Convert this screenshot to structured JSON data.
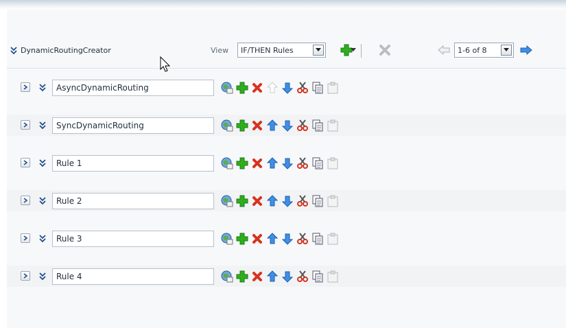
{
  "header": {
    "title": "DynamicRoutingCreator",
    "view_label": "View",
    "view_value": "IF/THEN Rules",
    "pager_value": "1-6 of 8"
  },
  "icons": {
    "expand": "double-chevron-down-icon",
    "add": "green-plus-icon",
    "delete": "red-x-icon",
    "up": "blue-up-arrow-icon",
    "down": "blue-down-arrow-icon",
    "cut": "scissors-icon",
    "copy": "copy-icon",
    "paste": "paste-icon"
  },
  "colors": {
    "add": "#2fae1e",
    "delete": "#d8321e",
    "arrow": "#3f8fe6",
    "disabled": "#c9ced4"
  },
  "rules": [
    {
      "name": "AsyncDynamicRouting",
      "up_enabled": false
    },
    {
      "name": "SyncDynamicRouting",
      "up_enabled": true
    },
    {
      "name": "Rule 1",
      "up_enabled": true
    },
    {
      "name": "Rule 2",
      "up_enabled": true
    },
    {
      "name": "Rule 3",
      "up_enabled": true
    },
    {
      "name": "Rule 4",
      "up_enabled": true
    }
  ]
}
